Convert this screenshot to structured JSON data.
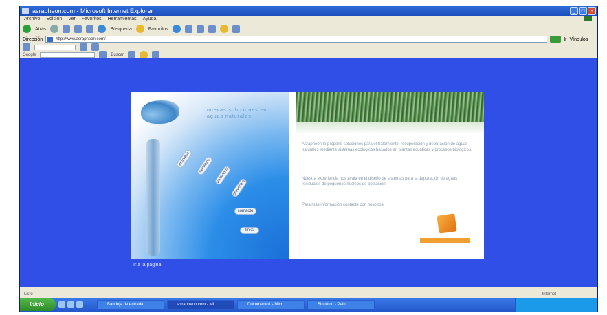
{
  "window": {
    "title": "asrapheon.com - Microsoft Internet Explorer",
    "controls": [
      "_",
      "□",
      "×"
    ]
  },
  "menu": [
    "Archivo",
    "Edición",
    "Ver",
    "Favoritos",
    "Herramientas",
    "Ayuda"
  ],
  "toolbar": {
    "back_label": "Atrás",
    "search_label": "Búsqueda",
    "favorites_label": "Favoritos"
  },
  "address": {
    "label": "Dirección",
    "value": "http://www.asrapheon.com/",
    "go_label": "Ir",
    "links_label": "Vínculos"
  },
  "googlebar": {
    "label": "Google",
    "search_label": "Buscar",
    "placeholder": ""
  },
  "site": {
    "tagline": "nuevas soluciones en aguas naturales",
    "menu_buttons": [
      "empresa",
      "servicios",
      "productos",
      "proyectos",
      "contacto",
      "links"
    ],
    "paragraphs": [
      "Asrapheon le propone soluciones para el tratamiento, recuperación y depuración de aguas naturales mediante sistemas ecológicos basados en plantas acuáticas y procesos biológicos.",
      "Nuestra experiencia nos avala en el diseño de sistemas para la depuración de aguas residuales de pequeños núcleos de población.",
      "Para más información contacte con nosotros."
    ],
    "below_link": "Ir a la página"
  },
  "status": {
    "left": "Listo",
    "zone": "Internet"
  },
  "taskbar": {
    "start_label": "Inicio",
    "tasks": [
      "Bandeja de entrada",
      "asrapheon.com - Mi...",
      "Documento1 - Micr...",
      "Sin título - Paint"
    ]
  },
  "colors": {
    "page_background": "#2f4fe6",
    "titlebar": "#1c4fbd",
    "accent_orange": "#f0a030"
  }
}
